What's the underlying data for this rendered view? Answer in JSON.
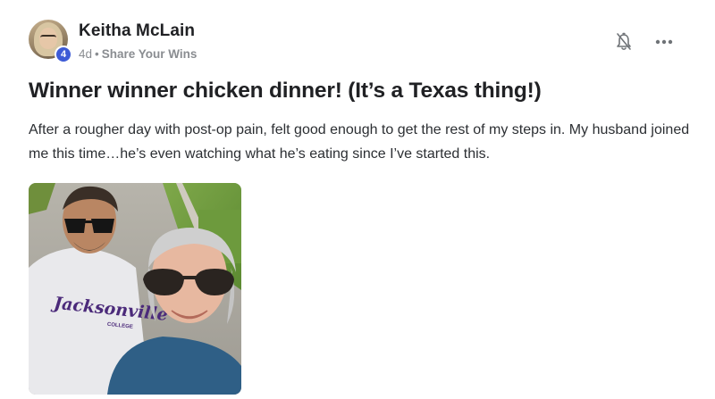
{
  "post": {
    "author": {
      "name": "Keitha McLain",
      "level": "4",
      "avatar_icon": "profile-photo"
    },
    "meta": {
      "time_ago": "4d",
      "separator": "•",
      "category": "Share Your Wins"
    },
    "actions": {
      "notify_icon": "bell-off-icon",
      "more_icon": "more-horizontal-icon"
    },
    "title": "Winner winner chicken dinner! (It’s a Texas thing!)",
    "body": "After a rougher day with post-op pain, felt good enough to get the rest of my steps in. My husband joined me this time…he’s even watching what he’s eating since I’ve started this.",
    "image": {
      "shirt_text": "Jacksonville",
      "shirt_subtext": "COLLEGE"
    }
  },
  "colors": {
    "badge": "#3d5bd6",
    "text": "#202124",
    "muted": "#8a8d91",
    "shirt_print": "#4b2a7a"
  }
}
